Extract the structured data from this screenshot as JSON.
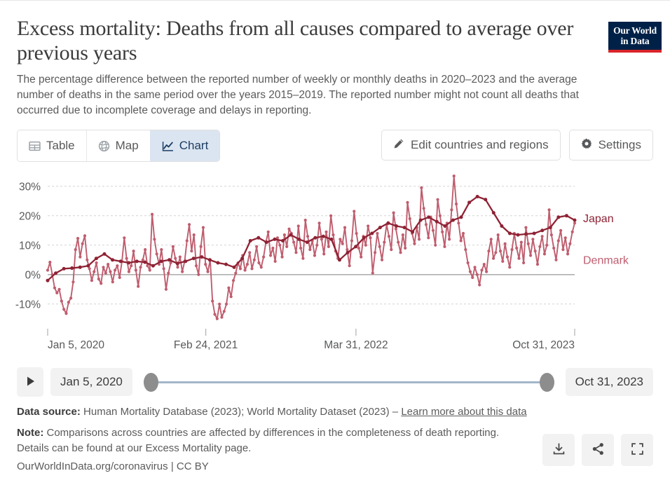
{
  "header": {
    "title": "Excess mortality: Deaths from all causes compared to average over previous years",
    "subtitle": "The percentage difference between the reported number of weekly or monthly deaths in 2020–2023 and the average number of deaths in the same period over the years 2015–2019. The reported number might not count all deaths that occurred due to incomplete coverage and delays in reporting.",
    "logo_line1": "Our World",
    "logo_line2": "in Data"
  },
  "controls": {
    "tabs": [
      {
        "label": "Table",
        "icon": "table-icon",
        "active": false
      },
      {
        "label": "Map",
        "icon": "globe-icon",
        "active": false
      },
      {
        "label": "Chart",
        "icon": "line-chart-icon",
        "active": true
      }
    ],
    "edit_button": "Edit countries and regions",
    "settings_button": "Settings"
  },
  "timeline": {
    "play_label": "play",
    "start_date": "Jan 5, 2020",
    "end_date": "Oct 31, 2023"
  },
  "footer": {
    "source_label": "Data source:",
    "source_text": "Human Mortality Database (2023); World Mortality Dataset (2023)",
    "source_separator": "–",
    "source_link": "Learn more about this data",
    "note_label": "Note:",
    "note_text": "Comparisons across countries are affected by differences in the completeness of death reporting. Details can be found at our Excess Mortality page.",
    "license": "OurWorldInData.org/coronavirus | CC BY",
    "actions": [
      {
        "name": "download-icon",
        "title": "Download"
      },
      {
        "name": "share-icon",
        "title": "Share"
      },
      {
        "name": "fullscreen-icon",
        "title": "Expand"
      }
    ]
  },
  "chart_data": {
    "type": "line",
    "title": "Excess mortality: Deaths from all causes compared to average over previous years",
    "xlabel": "",
    "ylabel": "",
    "ylim": [
      -16,
      34
    ],
    "yticks": [
      -10,
      0,
      10,
      20,
      30
    ],
    "ytick_labels": [
      "-10%",
      "0%",
      "10%",
      "20%",
      "30%"
    ],
    "grid": true,
    "legend_position": "right-inline",
    "zero_line": 0,
    "x_range": [
      "2020-01-05",
      "2023-10-31"
    ],
    "xticks": [
      "2020-01-05",
      "2021-02-24",
      "2022-03-31",
      "2023-10-31"
    ],
    "xtick_labels": [
      "Jan 5, 2020",
      "Feb 24, 2021",
      "Mar 31, 2022",
      "Oct 31, 2023"
    ],
    "series": [
      {
        "name": "Denmark",
        "color": "#bf5d6e",
        "frequency": "weekly",
        "label_y": 4.8,
        "values": [
          1.5,
          4.2,
          0.0,
          -4.5,
          -6.2,
          -5.0,
          -9.0,
          -11.8,
          -13.2,
          -9.4,
          -8.0,
          -2.5,
          8.5,
          12.3,
          6.0,
          10.5,
          13.2,
          5.0,
          2.0,
          -2.0,
          1.0,
          4.0,
          -1.5,
          -3.0,
          2.5,
          0.5,
          3.5,
          1.0,
          -2.5,
          1.5,
          3.0,
          -1.0,
          4.5,
          12.5,
          5.5,
          1.0,
          3.0,
          8.0,
          1.5,
          -4.0,
          2.5,
          5.0,
          8.5,
          3.0,
          1.5,
          20.5,
          12.0,
          7.0,
          3.5,
          8.5,
          2.0,
          -5.0,
          0.5,
          4.0,
          9.5,
          5.5,
          2.5,
          6.0,
          1.0,
          4.5,
          11.5,
          17.0,
          8.0,
          13.5,
          3.0,
          0.0,
          9.5,
          16.0,
          3.5,
          1.0,
          5.0,
          -9.0,
          -13.5,
          -15.0,
          -10.0,
          -14.5,
          -12.5,
          -10.0,
          -4.5,
          -7.5,
          -2.0,
          0.5,
          4.0,
          2.0,
          6.5,
          1.5,
          3.5,
          7.5,
          2.0,
          5.0,
          9.5,
          4.0,
          2.5,
          6.0,
          11.0,
          14.5,
          6.5,
          9.0,
          4.5,
          12.5,
          10.0,
          6.0,
          13.5,
          9.5,
          15.5,
          14.0,
          11.0,
          7.5,
          16.5,
          9.0,
          5.5,
          18.5,
          13.0,
          8.5,
          11.5,
          6.5,
          10.0,
          17.5,
          12.0,
          7.0,
          14.5,
          9.5,
          20.0,
          13.5,
          8.0,
          5.5,
          12.0,
          10.5,
          16.0,
          8.5,
          3.0,
          11.5,
          21.5,
          14.0,
          9.0,
          6.0,
          13.0,
          10.0,
          16.5,
          12.5,
          0.5,
          7.5,
          14.0,
          9.5,
          5.0,
          11.0,
          17.0,
          13.0,
          8.5,
          21.0,
          15.5,
          11.0,
          7.5,
          13.5,
          9.0,
          24.5,
          19.0,
          14.0,
          10.5,
          16.0,
          12.0,
          29.5,
          22.5,
          17.0,
          12.5,
          19.5,
          15.0,
          10.0,
          25.5,
          20.0,
          14.5,
          9.5,
          17.5,
          12.0,
          22.0,
          33.5,
          24.0,
          17.5,
          11.5,
          14.0,
          8.5,
          4.0,
          1.0,
          -1.0,
          2.5,
          0.0,
          -3.5,
          1.5,
          3.5,
          1.0,
          8.0,
          12.0,
          5.5,
          7.5,
          13.5,
          8.0,
          4.5,
          10.5,
          6.0,
          2.5,
          8.5,
          14.0,
          9.0,
          5.5,
          11.0,
          4.0,
          16.0,
          10.5,
          6.5,
          12.0,
          8.0,
          3.5,
          9.5,
          13.0,
          7.0,
          10.0,
          22.0,
          13.5,
          9.0,
          5.0,
          11.5,
          15.0,
          8.5,
          12.5,
          7.0,
          10.5,
          14.5,
          17.5
        ]
      },
      {
        "name": "Japan",
        "color": "#8e2234",
        "frequency": "monthly",
        "label_y": 19.0,
        "values": [
          -2.0,
          0.5,
          2.0,
          2.2,
          2.5,
          3.0,
          5.5,
          7.0,
          5.0,
          4.5,
          4.0,
          4.5,
          4.2,
          3.0,
          4.5,
          5.0,
          3.8,
          4.5,
          5.5,
          6.0,
          5.0,
          4.0,
          3.5,
          2.5,
          5.5,
          11.5,
          12.5,
          11.0,
          12.0,
          11.5,
          13.5,
          12.0,
          11.0,
          12.5,
          13.0,
          12.0,
          5.0,
          7.5,
          9.5,
          12.5,
          14.0,
          16.0,
          17.5,
          16.5,
          16.0,
          14.5,
          18.5,
          19.5,
          18.0,
          16.5,
          18.5,
          19.5,
          24.5,
          26.5,
          25.5,
          21.0,
          16.5,
          14.0,
          13.5,
          13.8,
          14.0,
          15.0,
          16.0,
          19.5,
          20.0,
          18.5
        ]
      }
    ]
  }
}
